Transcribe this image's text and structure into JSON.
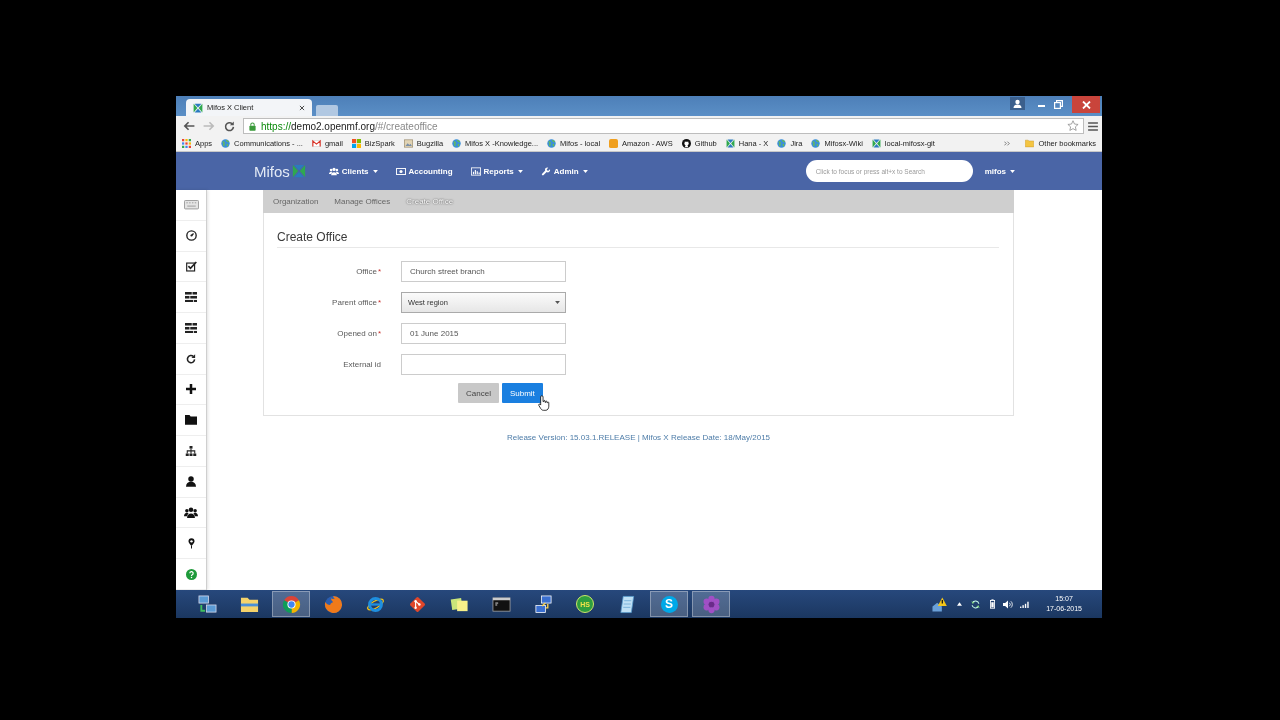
{
  "browser": {
    "tab": {
      "title": "Mifos X Client"
    },
    "url": {
      "scheme": "https://",
      "host": "demo2.openmf.org",
      "path": "/#/createoffice"
    },
    "bookmarks": [
      {
        "label": "Apps"
      },
      {
        "label": "Communications - ..."
      },
      {
        "label": "gmail"
      },
      {
        "label": "BizSpark"
      },
      {
        "label": "Bugzilla"
      },
      {
        "label": "Mifos X -Knowledge..."
      },
      {
        "label": "Mifos - local"
      },
      {
        "label": "Amazon - AWS"
      },
      {
        "label": "Github"
      },
      {
        "label": "Hana - X"
      },
      {
        "label": "Jira"
      },
      {
        "label": "Mifosx-Wiki"
      },
      {
        "label": "local-mifosx-git"
      }
    ],
    "other_bookmarks": "Other bookmarks"
  },
  "navbar": {
    "brand": "Mifos",
    "menus": [
      {
        "label": "Clients",
        "dropdown": true
      },
      {
        "label": "Accounting",
        "dropdown": false
      },
      {
        "label": "Reports",
        "dropdown": true
      },
      {
        "label": "Admin",
        "dropdown": true
      }
    ],
    "search": {
      "placeholder": "Click to focus or press alt+x to Search"
    },
    "user": {
      "label": "mifos",
      "dropdown": true
    }
  },
  "breadcrumb": [
    {
      "label": "Organization",
      "current": false
    },
    {
      "label": "Manage Offices",
      "current": false
    },
    {
      "label": "Create Office",
      "current": true
    }
  ],
  "form": {
    "title": "Create Office",
    "fields": [
      {
        "label": "Office",
        "required_mark": "*",
        "kind": "text",
        "value": "Church street branch"
      },
      {
        "label": "Parent office",
        "required_mark": "*",
        "kind": "select",
        "value": "West region"
      },
      {
        "label": "Opened on",
        "required_mark": "*",
        "kind": "text",
        "value": "01 June 2015"
      },
      {
        "label": "External id",
        "kind": "text"
      }
    ],
    "buttons": [
      {
        "label": "Cancel",
        "kind": "secondary"
      },
      {
        "label": "Submit",
        "kind": "primary"
      }
    ]
  },
  "footer": "Release Version: 15.03.1.RELEASE | Mifos X Release Date: 18/May/2015",
  "taskbar": {
    "apps": [
      {
        "running": false
      },
      {
        "running": false
      },
      {
        "running": true
      },
      {
        "running": false
      },
      {
        "running": false
      },
      {
        "running": false
      },
      {
        "running": false
      },
      {
        "running": false
      },
      {
        "running": false
      },
      {
        "running": false,
        "text": "HS"
      },
      {
        "running": false
      },
      {
        "running": true,
        "text": "S"
      },
      {
        "running": true
      }
    ],
    "clock": {
      "time": "15:07",
      "date": "17-06-2015"
    }
  }
}
